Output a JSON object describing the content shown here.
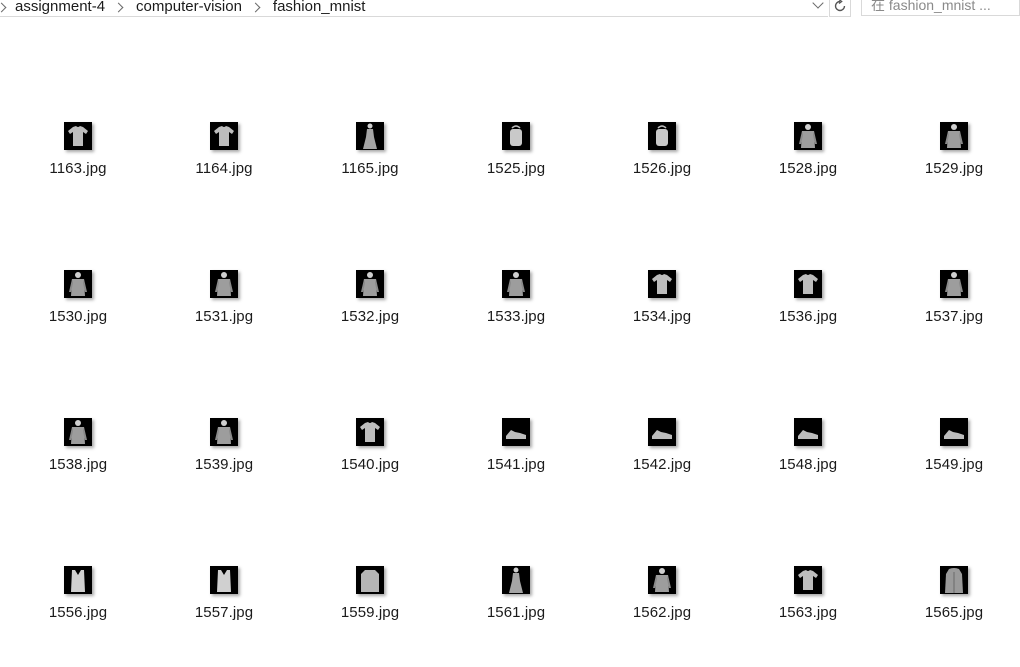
{
  "address_bar": {
    "breadcrumbs": [
      "assignment-4",
      "computer-vision",
      "fashion_mnist"
    ]
  },
  "search": {
    "placeholder": "在 fashion_mnist ..."
  },
  "files": [
    {
      "name": "1163.jpg",
      "icon": "tshirt"
    },
    {
      "name": "1164.jpg",
      "icon": "tshirt"
    },
    {
      "name": "1165.jpg",
      "icon": "dress"
    },
    {
      "name": "1525.jpg",
      "icon": "bag"
    },
    {
      "name": "1526.jpg",
      "icon": "bag"
    },
    {
      "name": "1528.jpg",
      "icon": "shirt"
    },
    {
      "name": "1529.jpg",
      "icon": "shirt"
    },
    {
      "name": "1530.jpg",
      "icon": "shirt"
    },
    {
      "name": "1531.jpg",
      "icon": "shirt"
    },
    {
      "name": "1532.jpg",
      "icon": "shirt"
    },
    {
      "name": "1533.jpg",
      "icon": "shirt"
    },
    {
      "name": "1534.jpg",
      "icon": "tshirt"
    },
    {
      "name": "1536.jpg",
      "icon": "tshirt"
    },
    {
      "name": "1537.jpg",
      "icon": "shirt"
    },
    {
      "name": "1538.jpg",
      "icon": "shirt"
    },
    {
      "name": "1539.jpg",
      "icon": "shirt"
    },
    {
      "name": "1540.jpg",
      "icon": "tshirt"
    },
    {
      "name": "1541.jpg",
      "icon": "shoe"
    },
    {
      "name": "1542.jpg",
      "icon": "shoe"
    },
    {
      "name": "1548.jpg",
      "icon": "shoe"
    },
    {
      "name": "1549.jpg",
      "icon": "shoe"
    },
    {
      "name": "1556.jpg",
      "icon": "top"
    },
    {
      "name": "1557.jpg",
      "icon": "top"
    },
    {
      "name": "1559.jpg",
      "icon": "pullover"
    },
    {
      "name": "1561.jpg",
      "icon": "dress"
    },
    {
      "name": "1562.jpg",
      "icon": "shirt"
    },
    {
      "name": "1563.jpg",
      "icon": "tshirt"
    },
    {
      "name": "1565.jpg",
      "icon": "coat"
    }
  ],
  "colors": {
    "thumb_bg": "#000000",
    "garment": "#bdbdbd",
    "text": "#1b1b1b"
  }
}
